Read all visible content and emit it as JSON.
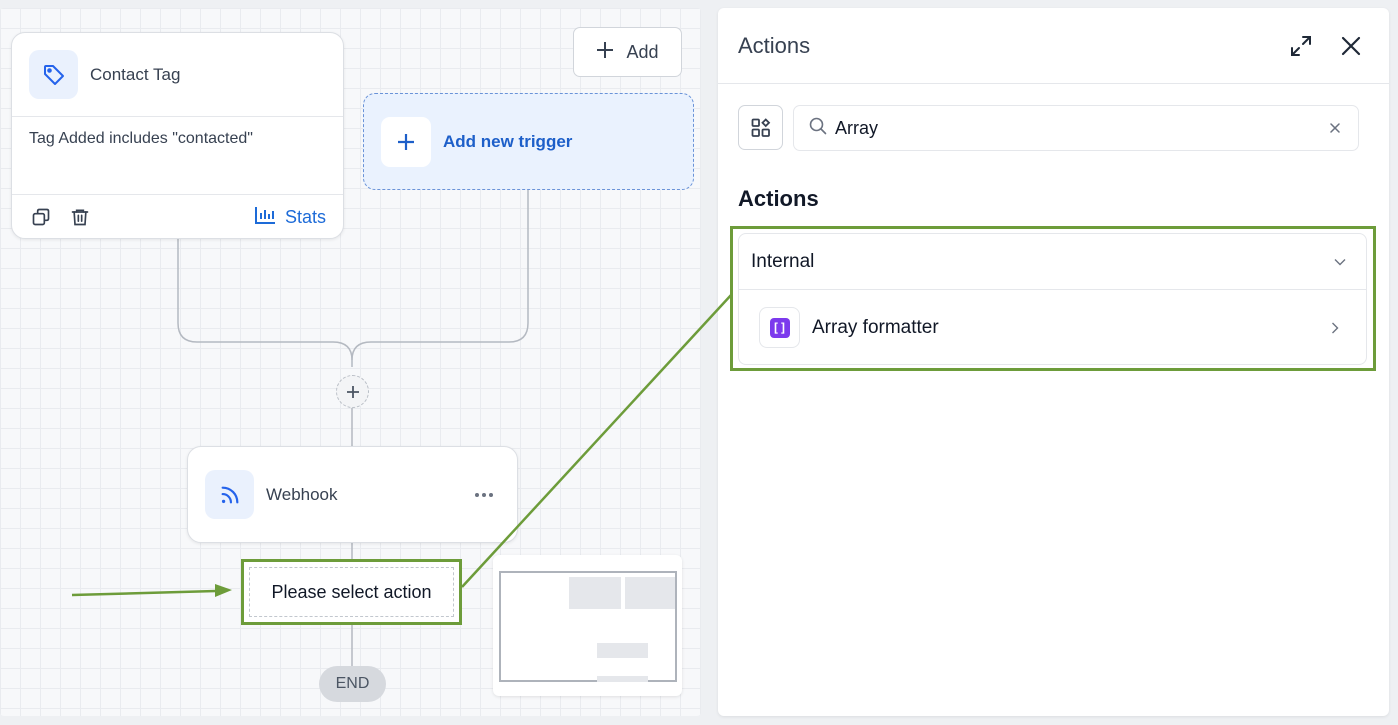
{
  "canvas": {
    "add_button": "Add",
    "trigger_card": {
      "title": "Contact Tag",
      "filter": "Tag Added includes \"contacted\"",
      "stats_label": "Stats"
    },
    "new_trigger": {
      "label": "Add new trigger"
    },
    "webhook": {
      "title": "Webhook"
    },
    "select_action": "Please select action",
    "end_label": "END"
  },
  "panel": {
    "title": "Actions",
    "search": {
      "value": "Array"
    },
    "section_heading": "Actions",
    "groups": [
      {
        "label": "Internal",
        "items": [
          {
            "label": "Array formatter"
          }
        ]
      }
    ]
  },
  "colors": {
    "accent_blue": "#1d6bd8",
    "annotation_green": "#6d9c3a",
    "formatter_purple": "#7c3aed"
  }
}
